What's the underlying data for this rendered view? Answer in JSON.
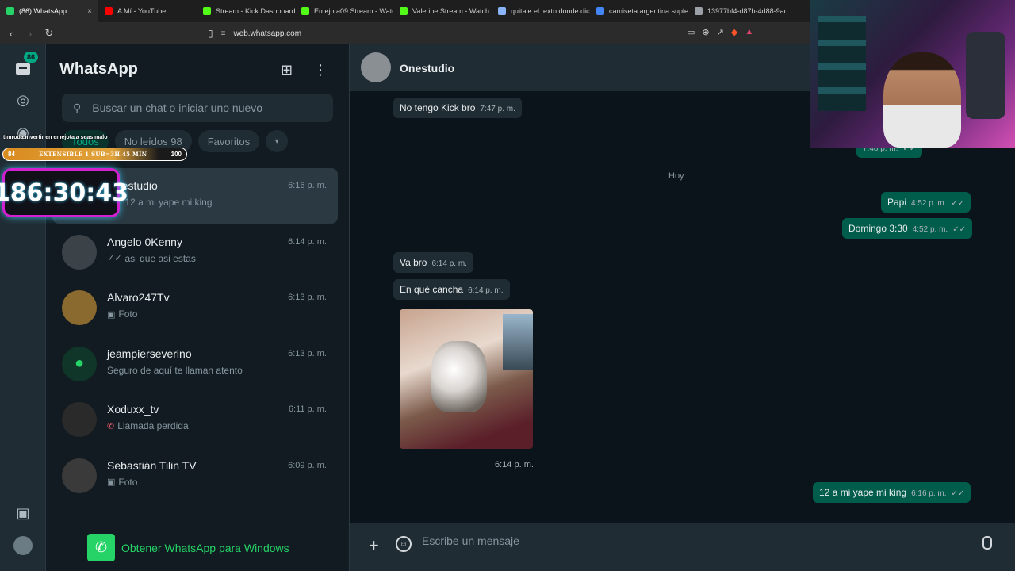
{
  "browser": {
    "tabs": [
      {
        "label": "(86) WhatsApp",
        "color": "#25d366",
        "active": true
      },
      {
        "label": "A Mí - YouTube",
        "color": "#ff0000"
      },
      {
        "label": "Stream - Kick Dashboard",
        "color": "#53fc18"
      },
      {
        "label": "Emejota09 Stream - Watc",
        "color": "#53fc18"
      },
      {
        "label": "Valerihe Stream - Watch l",
        "color": "#53fc18"
      },
      {
        "label": "quitale el texto donde dic",
        "color": "#8ab4f8"
      },
      {
        "label": "camiseta argentina suplen",
        "color": "#4285f4"
      },
      {
        "label": "13977bf4-d87b-4d88-9ac",
        "color": "#9aa0a6"
      }
    ],
    "url": "web.whatsapp.com"
  },
  "rail": {
    "badge": "86"
  },
  "list": {
    "title": "WhatsApp",
    "search_placeholder": "Buscar un chat o iniciar uno nuevo",
    "filters": [
      "Todos",
      "No leídos 98",
      "Favoritos"
    ],
    "chats": [
      {
        "name": "Onestudio",
        "time": "6:16 p. m.",
        "preview": "12 a mi yape mi king",
        "icon": "double-check-icon",
        "avatar": "#6d7478"
      },
      {
        "name": "Angelo 0Kenny",
        "time": "6:14 p. m.",
        "preview": "asi que asi estas",
        "icon": "double-check-icon",
        "avatar": "#3c4348"
      },
      {
        "name": "Alvaro247Tv",
        "time": "6:13 p. m.",
        "preview": "Foto",
        "icon": "photo-icon",
        "avatar": "#8a6a2f"
      },
      {
        "name": "jeampierseverino",
        "time": "6:13 p. m.",
        "preview": "Seguro de aquí te llaman atento",
        "icon": "",
        "avatar": "#103529"
      },
      {
        "name": "Xoduxx_tv",
        "time": "6:11 p. m.",
        "preview": "Llamada perdida",
        "icon": "missed-call-icon",
        "avatar": "#2a2a2a"
      },
      {
        "name": "Sebastián Tilin TV",
        "time": "6:09 p. m.",
        "preview": "Foto",
        "icon": "photo-icon",
        "avatar": "#3a3a3a"
      }
    ],
    "get_windows": "Obtener WhatsApp para Windows"
  },
  "conversation": {
    "name": "Onestudio",
    "messages": [
      {
        "text": "No tengo Kick bro",
        "time": "7:47 p. m.",
        "dir": "in"
      },
      {
        "text": "",
        "time": "7:48 p. m.",
        "dir": "out"
      },
      {
        "text": "Papi",
        "time": "4:52 p. m.",
        "dir": "out"
      },
      {
        "text": "Domingo 3:30",
        "time": "4:52 p. m.",
        "dir": "out"
      },
      {
        "text": "Va bro",
        "time": "6:14 p. m.",
        "dir": "in"
      },
      {
        "text": "En qué cancha",
        "time": "6:14 p. m.",
        "dir": "in"
      },
      {
        "text": "12 a mi yape mi king",
        "time": "6:16 p. m.",
        "dir": "out"
      }
    ],
    "day_label": "Hoy",
    "image_time": "6:14 p. m.",
    "input_placeholder": "Escribe un mensaje"
  },
  "overlay": {
    "label": "timroda invertir en emejota a seas malo",
    "sub_left": "84",
    "sub_mid": "EXTENSIBLE 1 SUB=3H.45 MIN",
    "sub_right": "100",
    "timer": "186:30:43"
  }
}
